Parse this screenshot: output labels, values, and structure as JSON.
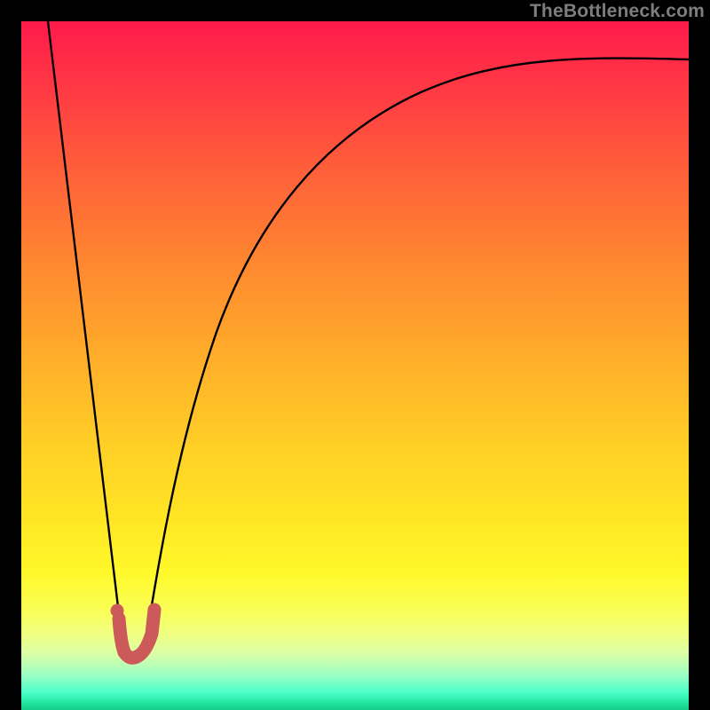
{
  "attribution": "TheBottleneck.com",
  "chart_data": {
    "type": "line",
    "title": "",
    "xlabel": "",
    "ylabel": "",
    "xlim": [
      0,
      100
    ],
    "ylim": [
      0,
      100
    ],
    "series": [
      {
        "name": "left-falling-line",
        "x": [
          4.0,
          15.3
        ],
        "y": [
          100,
          8.5
        ]
      },
      {
        "name": "rising-curve",
        "x": [
          18.5,
          20,
          22,
          25,
          30,
          40,
          55,
          75,
          100
        ],
        "y": [
          9,
          18,
          30,
          45,
          60,
          77,
          87,
          92,
          94.5
        ]
      }
    ],
    "markers": {
      "name": "bottom-hook",
      "color": "#cc5a5a",
      "points": [
        {
          "x": 14.6,
          "y": 13.3
        },
        {
          "x": 14.9,
          "y": 10.2
        },
        {
          "x": 15.5,
          "y": 8.4
        },
        {
          "x": 16.6,
          "y": 7.8
        },
        {
          "x": 17.9,
          "y": 8.0
        },
        {
          "x": 19.2,
          "y": 11.0
        },
        {
          "x": 19.9,
          "y": 14.6
        }
      ]
    },
    "gradient_bands": [
      {
        "pos": 0,
        "color": "#ff1a4b"
      },
      {
        "pos": 50,
        "color": "#ffb928"
      },
      {
        "pos": 80,
        "color": "#fff82a"
      },
      {
        "pos": 100,
        "color": "#18cc8a"
      }
    ]
  }
}
